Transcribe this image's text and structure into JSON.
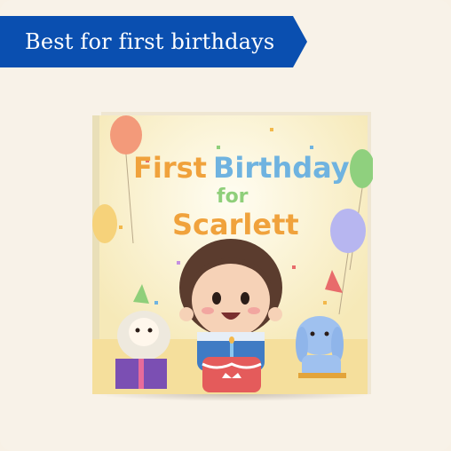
{
  "badge": {
    "label": "Best for first birthdays",
    "color": "#0a4fb0"
  },
  "book": {
    "title_line1_word1": "First",
    "title_line1_word2": "Birthday",
    "title_line2": "for",
    "title_line3": "Scarlett",
    "publisher_logo": "crown-logo"
  },
  "colors": {
    "background": "#f8f2e8",
    "cover_bg": "#fbf3d6"
  }
}
